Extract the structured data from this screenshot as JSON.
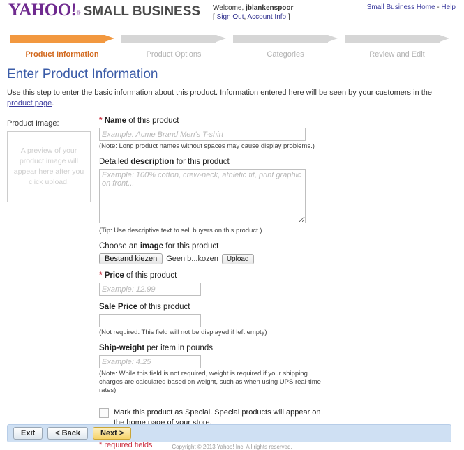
{
  "header": {
    "brand_yahoo": "YAHOO!",
    "brand_reg": "®",
    "brand_sub": "SMALL BUSINESS",
    "welcome_prefix": "Welcome,",
    "welcome_user": "jblankenspoor",
    "bracket_open": "[",
    "sign_out": "Sign Out",
    "comma": ",",
    "account_info": "Account Info",
    "bracket_close": "]",
    "home_link": "Small Business Home",
    "link_sep": "-",
    "help_link": "Help"
  },
  "steps": [
    {
      "label": "Product Information",
      "active": true
    },
    {
      "label": "Product Options",
      "active": false
    },
    {
      "label": "Categories",
      "active": false
    },
    {
      "label": "Review and Edit",
      "active": false
    }
  ],
  "page": {
    "title": "Enter Product Information",
    "intro_before": "Use this step to enter the basic information about this product. Information entered here will be seen by your customers in the ",
    "intro_link": "product page",
    "intro_after": "."
  },
  "left": {
    "image_label": "Product Image:",
    "preview_text": "A preview of your product image will appear here after you click upload."
  },
  "form": {
    "name": {
      "required_mark": "*",
      "label_bold": "Name",
      "label_rest": " of this product",
      "placeholder": "Example: Acme Brand Men's T-shirt",
      "value": "",
      "note": "(Note: Long product names without spaces may cause display problems.)"
    },
    "description": {
      "label_pre": "Detailed ",
      "label_bold": "description",
      "label_rest": " for this product",
      "placeholder": "Example: 100% cotton, crew-neck, athletic fit, print graphic on front...",
      "value": "",
      "note": "(Tip: Use descriptive text to sell buyers on this product.)"
    },
    "image": {
      "label_pre": "Choose an ",
      "label_bold": "image",
      "label_rest": " for this product",
      "choose_button": "Bestand kiezen",
      "file_status": "Geen b...kozen",
      "upload_button": "Upload"
    },
    "price": {
      "required_mark": "*",
      "label_bold": "Price",
      "label_rest": " of this product",
      "placeholder": "Example: 12.99",
      "value": ""
    },
    "sale_price": {
      "label_bold": "Sale Price",
      "label_rest": " of this product",
      "placeholder": "",
      "value": "",
      "note": "(Not required. This field will not be displayed if left empty)"
    },
    "ship_weight": {
      "label_bold": "Ship-weight",
      "label_rest": " per item in pounds",
      "placeholder": "Example: 4.25",
      "value": "",
      "note": "(Note: While this field is not required, weight is required if your shipping charges are calculated based on weight, such as when using UPS real-time rates)"
    },
    "special": {
      "checked": false,
      "text": "Mark this product as Special. Special products will appear on the home page of your store."
    },
    "required_fields_note": "* required fields"
  },
  "footer": {
    "exit_button": "Exit",
    "back_button": "< Back",
    "next_button": "Next >",
    "copyright": "Copyright © 2013 Yahoo! Inc. All rights reserved."
  },
  "colors": {
    "brand_purple": "#6f2a8f",
    "step_active": "#f2983f",
    "step_inactive": "#d6d6d6",
    "title_blue": "#3b5ca8",
    "required_red": "#cc3344",
    "button_bar": "#cfe0f3",
    "next_button": "#f6d36a"
  }
}
